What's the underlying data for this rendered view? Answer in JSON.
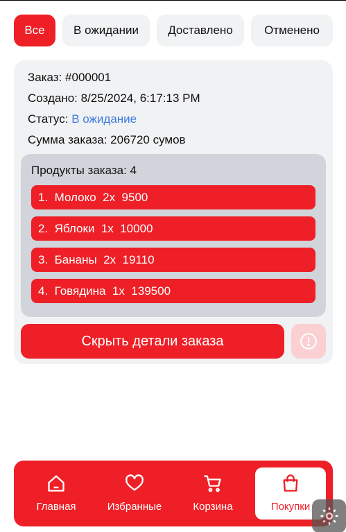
{
  "tabs": [
    {
      "label": "Все",
      "active": true
    },
    {
      "label": "В ожидании",
      "active": false
    },
    {
      "label": "Доставлено",
      "active": false
    },
    {
      "label": "Отменено",
      "active": false
    }
  ],
  "order": {
    "number_label": "Заказ: #000001",
    "created_label": "Создано: 8/25/2024, 6:17:13 PM",
    "status_prefix": "Статус:",
    "status_value": "В ожидание",
    "status_color": "#3d7be0",
    "total_label": "Сумма заказа: 206720 сумов",
    "products_title": "Продукты заказа: 4",
    "products": [
      {
        "text": "1.  Молоко  2x  9500"
      },
      {
        "text": "2.  Яблоки  1x  10000"
      },
      {
        "text": "3.  Бананы  2x  19110"
      },
      {
        "text": "4.  Говядина  1x  139500"
      }
    ],
    "hide_button_label": "Скрыть детали заказа",
    "warning_icon": "exclamation-circle-icon"
  },
  "bottom_nav": [
    {
      "label": "Главная",
      "icon": "home-icon",
      "active": false
    },
    {
      "label": "Избранные",
      "icon": "heart-icon",
      "active": false
    },
    {
      "label": "Корзина",
      "icon": "cart-icon",
      "active": false
    },
    {
      "label": "Покупки",
      "icon": "bag-icon",
      "active": true
    }
  ],
  "colors": {
    "accent": "#ee1f26",
    "card_bg": "#f1f2f4",
    "products_bg": "#d1d4db"
  }
}
